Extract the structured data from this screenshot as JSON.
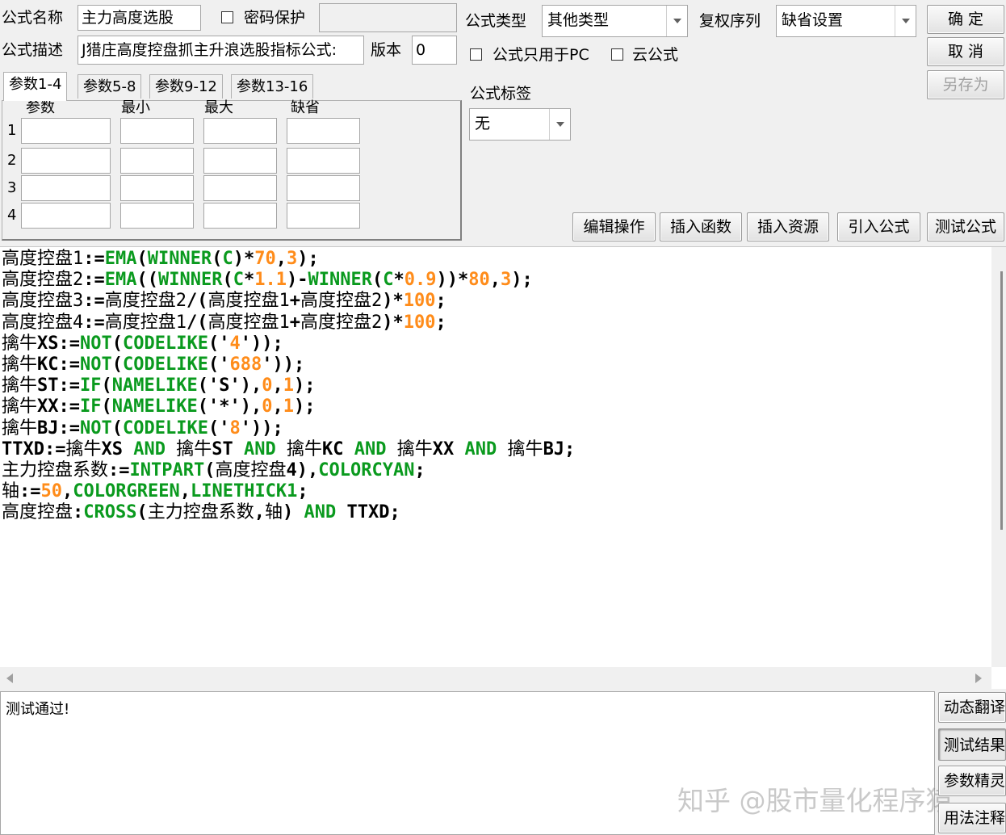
{
  "form": {
    "name_label": "公式名称",
    "name_value": "主力高度选股",
    "password_label": "密码保护",
    "desc_label": "公式描述",
    "desc_value": "J猎庄高度控盘抓主升浪选股指标公式:",
    "version_label": "版本",
    "version_value": "0",
    "type_label": "公式类型",
    "type_value": "其他类型",
    "fq_label": "复权序列",
    "fq_value": "缺省设置",
    "pc_only_label": "公式只用于PC",
    "cloud_label": "云公式",
    "tag_label": "公式标签",
    "tag_value": "无"
  },
  "buttons": {
    "ok": "确 定",
    "cancel": "取 消",
    "save_as": "另存为",
    "edit_ops": "编辑操作",
    "insert_func": "插入函数",
    "insert_res": "插入资源",
    "import_formula": "引入公式",
    "test_formula": "测试公式",
    "dyn_translate": "动态翻译",
    "test_result": "测试结果",
    "param_wizard": "参数精灵",
    "usage_notes": "用法注释"
  },
  "params": {
    "tabs": [
      "参数1-4",
      "参数5-8",
      "参数9-12",
      "参数13-16"
    ],
    "headers": [
      "参数",
      "最小",
      "最大",
      "缺省"
    ],
    "rows": [
      "1",
      "2",
      "3",
      "4"
    ]
  },
  "code_lines": [
    [
      [
        "id",
        "高度控盘1"
      ],
      [
        "op",
        ":="
      ],
      [
        "fn",
        "EMA"
      ],
      [
        "op",
        "("
      ],
      [
        "fn",
        "WINNER"
      ],
      [
        "op",
        "("
      ],
      [
        "fn",
        "C"
      ],
      [
        "op",
        ")*"
      ],
      [
        "num",
        "70"
      ],
      [
        "op",
        ","
      ],
      [
        "num",
        "3"
      ],
      [
        "op",
        ");"
      ]
    ],
    [
      [
        "id",
        "高度控盘2"
      ],
      [
        "op",
        ":="
      ],
      [
        "fn",
        "EMA"
      ],
      [
        "op",
        "(("
      ],
      [
        "fn",
        "WINNER"
      ],
      [
        "op",
        "("
      ],
      [
        "fn",
        "C"
      ],
      [
        "op",
        "*"
      ],
      [
        "num",
        "1.1"
      ],
      [
        "op",
        ")-"
      ],
      [
        "fn",
        "WINNER"
      ],
      [
        "op",
        "("
      ],
      [
        "fn",
        "C"
      ],
      [
        "op",
        "*"
      ],
      [
        "num",
        "0.9"
      ],
      [
        "op",
        "))*"
      ],
      [
        "num",
        "80"
      ],
      [
        "op",
        ","
      ],
      [
        "num",
        "3"
      ],
      [
        "op",
        ");"
      ]
    ],
    [
      [
        "id",
        "高度控盘3"
      ],
      [
        "op",
        ":="
      ],
      [
        "id",
        "高度控盘2"
      ],
      [
        "op",
        "/("
      ],
      [
        "id",
        "高度控盘1"
      ],
      [
        "op",
        "+"
      ],
      [
        "id",
        "高度控盘2"
      ],
      [
        "op",
        ")*"
      ],
      [
        "num",
        "100"
      ],
      [
        "op",
        ";"
      ]
    ],
    [
      [
        "id",
        "高度控盘4"
      ],
      [
        "op",
        ":="
      ],
      [
        "id",
        "高度控盘1"
      ],
      [
        "op",
        "/("
      ],
      [
        "id",
        "高度控盘1"
      ],
      [
        "op",
        "+"
      ],
      [
        "id",
        "高度控盘2"
      ],
      [
        "op",
        ")*"
      ],
      [
        "num",
        "100"
      ],
      [
        "op",
        ";"
      ]
    ],
    [
      [
        "id",
        "擒牛"
      ],
      [
        "op",
        "XS:="
      ],
      [
        "fn",
        "NOT"
      ],
      [
        "op",
        "("
      ],
      [
        "fn",
        "CODELIKE"
      ],
      [
        "op",
        "('"
      ],
      [
        "num",
        "4"
      ],
      [
        "op",
        "'));"
      ]
    ],
    [
      [
        "id",
        "擒牛"
      ],
      [
        "op",
        "KC:="
      ],
      [
        "fn",
        "NOT"
      ],
      [
        "op",
        "("
      ],
      [
        "fn",
        "CODELIKE"
      ],
      [
        "op",
        "('"
      ],
      [
        "num",
        "688"
      ],
      [
        "op",
        "'));"
      ]
    ],
    [
      [
        "id",
        "擒牛"
      ],
      [
        "op",
        "ST:="
      ],
      [
        "fn",
        "IF"
      ],
      [
        "op",
        "("
      ],
      [
        "fn",
        "NAMELIKE"
      ],
      [
        "op",
        "('S'),"
      ],
      [
        "num",
        "0"
      ],
      [
        "op",
        ","
      ],
      [
        "num",
        "1"
      ],
      [
        "op",
        ");"
      ]
    ],
    [
      [
        "id",
        "擒牛"
      ],
      [
        "op",
        "XX:="
      ],
      [
        "fn",
        "IF"
      ],
      [
        "op",
        "("
      ],
      [
        "fn",
        "NAMELIKE"
      ],
      [
        "op",
        "('*'),"
      ],
      [
        "num",
        "0"
      ],
      [
        "op",
        ","
      ],
      [
        "num",
        "1"
      ],
      [
        "op",
        ");"
      ]
    ],
    [
      [
        "id",
        "擒牛"
      ],
      [
        "op",
        "BJ:="
      ],
      [
        "fn",
        "NOT"
      ],
      [
        "op",
        "("
      ],
      [
        "fn",
        "CODELIKE"
      ],
      [
        "op",
        "('"
      ],
      [
        "num",
        "8"
      ],
      [
        "op",
        "'));"
      ]
    ],
    [
      [
        "op",
        "TTXD:="
      ],
      [
        "id",
        "擒牛"
      ],
      [
        "op",
        "XS "
      ],
      [
        "kw",
        "AND"
      ],
      [
        "op",
        " "
      ],
      [
        "id",
        "擒牛"
      ],
      [
        "op",
        "ST "
      ],
      [
        "kw",
        "AND"
      ],
      [
        "op",
        " "
      ],
      [
        "id",
        "擒牛"
      ],
      [
        "op",
        "KC "
      ],
      [
        "kw",
        "AND"
      ],
      [
        "op",
        " "
      ],
      [
        "id",
        "擒牛"
      ],
      [
        "op",
        "XX "
      ],
      [
        "kw",
        "AND"
      ],
      [
        "op",
        " "
      ],
      [
        "id",
        "擒牛"
      ],
      [
        "op",
        "BJ;"
      ]
    ],
    [
      [
        "id",
        "主力控盘系数"
      ],
      [
        "op",
        ":="
      ],
      [
        "fn",
        "INTPART"
      ],
      [
        "op",
        "("
      ],
      [
        "id",
        "高度控盘"
      ],
      [
        "op",
        "4),"
      ],
      [
        "fn",
        "COLORCYAN"
      ],
      [
        "op",
        ";"
      ]
    ],
    [
      [
        "id",
        "轴"
      ],
      [
        "op",
        ":="
      ],
      [
        "num",
        "50"
      ],
      [
        "op",
        ","
      ],
      [
        "fn",
        "COLORGREEN"
      ],
      [
        "op",
        ","
      ],
      [
        "fn",
        "LINETHICK1"
      ],
      [
        "op",
        ";"
      ]
    ],
    [
      [
        "id",
        "高度控盘"
      ],
      [
        "op",
        ":"
      ],
      [
        "fn",
        "CROSS"
      ],
      [
        "op",
        "("
      ],
      [
        "id",
        "主力控盘系数"
      ],
      [
        "op",
        ","
      ],
      [
        "id",
        "轴"
      ],
      [
        "op",
        ") "
      ],
      [
        "kw",
        "AND"
      ],
      [
        "op",
        " TTXD;"
      ]
    ]
  ],
  "message": "测试通过!",
  "watermark": "知乎 @股市量化程序猿"
}
